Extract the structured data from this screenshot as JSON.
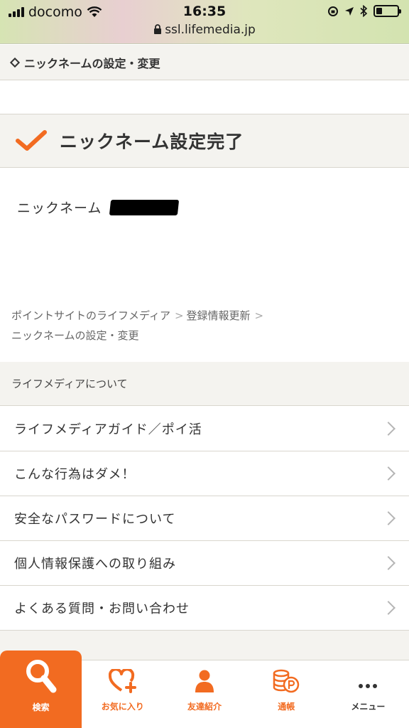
{
  "status_bar": {
    "carrier": "docomo",
    "time": "16:35",
    "url": "ssl.lifemedia.jp",
    "battery_level": 0.3
  },
  "page_header": {
    "title": "ニックネームの設定・変更"
  },
  "result": {
    "title": "ニックネーム設定完了",
    "nickname_label": "ニックネーム"
  },
  "breadcrumb": {
    "items": [
      "ポイントサイトのライフメディア",
      "登録情報更新",
      "ニックネームの設定・変更"
    ]
  },
  "about": {
    "heading": "ライフメディアについて",
    "links": [
      "ライフメディアガイド／ポイ活",
      "こんな行為はダメ！",
      "安全なパスワードについて",
      "個人情報保護への取り組み",
      "よくある質問・お問い合わせ"
    ]
  },
  "tabs": [
    {
      "label": "検索",
      "icon": "search-icon",
      "active": true
    },
    {
      "label": "お気に入り",
      "icon": "heart-plus-icon",
      "active": false
    },
    {
      "label": "友達紹介",
      "icon": "person-icon",
      "active": false
    },
    {
      "label": "通帳",
      "icon": "coins-icon",
      "active": false
    },
    {
      "label": "メニュー",
      "icon": "more-icon",
      "active": false
    }
  ],
  "colors": {
    "accent": "#f26b21",
    "band_bg": "#f4f3ef"
  }
}
